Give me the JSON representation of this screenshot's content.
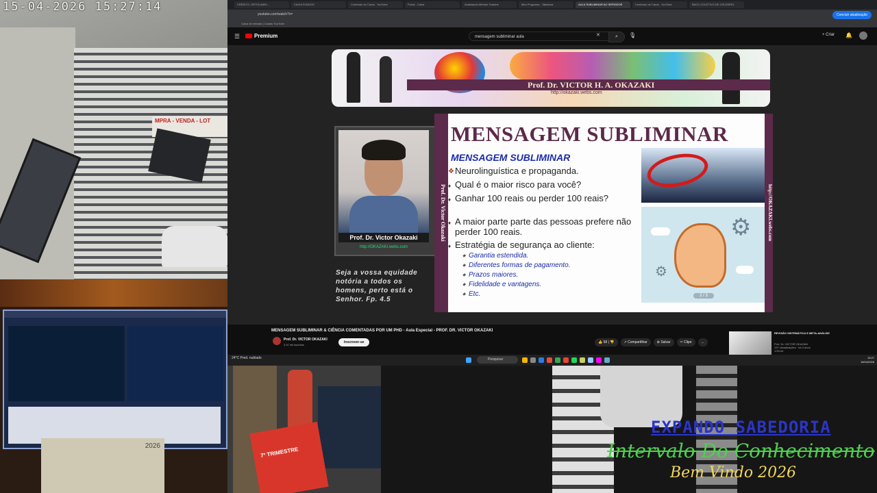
{
  "camera": {
    "timestamp": "15-04-2026 15:27:14",
    "sign_text": "MPRA - VENDA - LOT",
    "desk_year": "2026"
  },
  "browser": {
    "tabs": [
      "CRÉDITO, ORTOLANEL...",
      "CAIXA FUNDOS",
      "Conteúdo do Canal - YouTube",
      "Portal - Caixa",
      "Analisando Método Youtube",
      "Meu Programa - Tablatura",
      "AULA SUBLIMINAR AO SERVIDOR",
      "Conteúdo do Canal - YouTube",
      "BACO COLETIVO DE CRUZEIRO"
    ],
    "active_tab": 6,
    "url": "youtube.com/watch?v=",
    "sync_button": "Concluir atualização",
    "bookmarks": "Caixa de entrada | Canais YouTube",
    "youtube": {
      "logo_text": "Premium",
      "search_value": "mensagem subliminar aula",
      "create_label": "+ Criar"
    }
  },
  "slide": {
    "banner_name": "Prof. Dr. VICTOR H. A. OKAZAKI",
    "banner_url": "http://okazaki.webs.com",
    "photo_caption": "Prof. Dr. Victor Okazaki",
    "photo_url": "http://OKAZAKI.webs.com",
    "quote": "Seja a vossa equidade notória a todos os homens, perto está o Senhor. Fp. 4.5",
    "vertical_left": "Prof. Dr. Victor Okazaki",
    "vertical_right": "http://OKAZAKI.webs.com",
    "title": "MENSAGEM SUBLIMINAR",
    "subtitle": "MENSAGEM SUBLIMINAR",
    "bullets": [
      "Neurolinguística e propaganda.",
      "Qual é o maior risco para você?",
      "Ganhar 100 reais ou perder 100 reais?",
      "A maior parte parte das pessoas prefere não perder 100 reais.",
      "Estratégia de segurança ao cliente:"
    ],
    "sub_bullets": [
      "Garantia estendida.",
      "Diferentes formas de pagamento.",
      "Prazos maiores.",
      "Fidelidade e vantagens.",
      "Etc."
    ],
    "page_indicator": "2 / 3"
  },
  "video": {
    "title": "MENSAGEM SUBLIMINAR & CIÊNCIA COMENTADAS POR UM PHD - Aula Especial - PROF. DR. VICTOR OKAZAKI",
    "channel": "Prof. Dr. VICTOR OKAZAKI",
    "subscribers": "2,97 mil inscritos",
    "subscribe_label": "Inscrever-se",
    "likes": "58",
    "share_label": "Compartilhar",
    "save_label": "Salvar",
    "clip_label": "Clipe",
    "more_label": "...",
    "suggested": {
      "title": "REVISÃO SISTEMÁTICA E META-ANÁLISE",
      "channel": "Prof. Dr. VICTOR OKAZAKI",
      "meta": "137 visualizações · há 4 anos",
      "duration": "1:53:44"
    }
  },
  "taskbar": {
    "weather": "24°C Pred. nublado",
    "search_label": "Pesquisar",
    "time": "15:27",
    "date": "15/04/2026"
  },
  "overlay": {
    "line1": "EXPANDO SABEDORIA",
    "line2": "Intervalo Do Conhecimento",
    "line3": "Bem Vindo 2026",
    "bag_text": "7º TRIMESTRE"
  }
}
